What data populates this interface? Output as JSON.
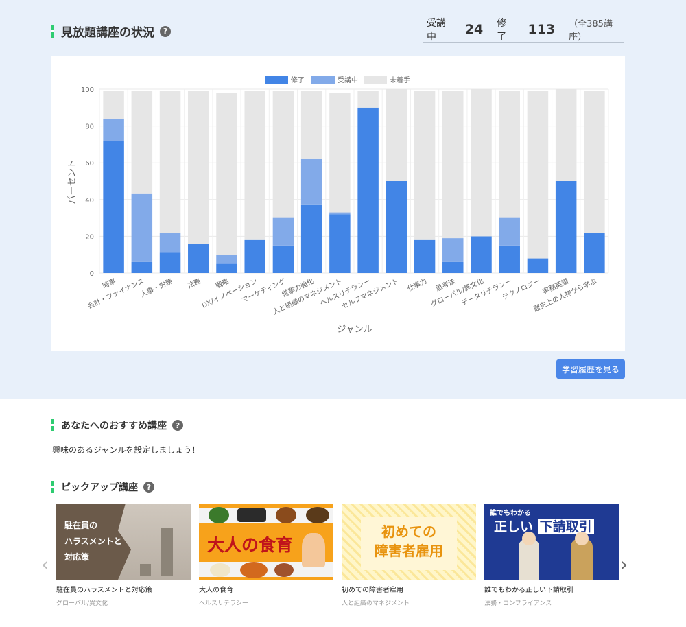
{
  "status_section": {
    "title": "見放題講座の状況",
    "help": "?",
    "stats": {
      "in_progress_label": "受講中",
      "in_progress_value": "24",
      "completed_label": "修了",
      "completed_value": "113",
      "total": "（全385講座）"
    }
  },
  "chart_data": {
    "type": "bar",
    "stacked": true,
    "orientation": "vertical",
    "categories": [
      "時事",
      "会計・ファイナンス",
      "人事・労務",
      "法務",
      "戦略",
      "DX/イノベーション",
      "マーケティング",
      "営業力強化",
      "人と組織のマネジメント",
      "ヘルスリテラシー",
      "セルフマネジメント",
      "仕事力",
      "思考法",
      "グローバル/異文化",
      "データリテラシー",
      "テクノロジー",
      "実務英語",
      "歴史上の人物から学ぶ"
    ],
    "series": [
      {
        "name": "修了",
        "color": "#4285e6",
        "values": [
          72,
          6,
          11,
          16,
          5,
          18,
          15,
          37,
          32,
          90,
          50,
          18,
          6,
          20,
          15,
          8,
          50,
          22
        ]
      },
      {
        "name": "受講中",
        "color": "#82aae9",
        "values": [
          12,
          37,
          11,
          0,
          5,
          0,
          15,
          25,
          1,
          0,
          0,
          0,
          13,
          0,
          15,
          0,
          0,
          0
        ]
      },
      {
        "name": "未着手",
        "color": "#e6e6e6",
        "values": [
          15,
          56,
          77,
          83,
          88,
          81,
          69,
          37,
          65,
          9,
          50,
          81,
          80,
          80,
          69,
          91,
          50,
          77
        ]
      }
    ],
    "xlabel": "ジャンル",
    "ylabel": "パーセント",
    "ylim": [
      0,
      100
    ],
    "yticks": [
      0,
      20,
      40,
      60,
      80,
      100
    ],
    "grid": true,
    "legend": "top-center"
  },
  "history_button": "学習履歴を見る",
  "recommend_section": {
    "title": "あなたへのおすすめ講座",
    "help": "?",
    "message": "興味のあるジャンルを設定しましょう！"
  },
  "pickup_section": {
    "title": "ピックアップ講座",
    "help": "?",
    "prev_arrow": "‹",
    "next_arrow": "›",
    "cards": [
      {
        "title": "駐在員のハラスメントと対応策",
        "genre": "グローバル/異文化",
        "thumb_lines": [
          "駐在員の",
          "ハラスメントと",
          "対応策"
        ]
      },
      {
        "title": "大人の食育",
        "genre": "ヘルスリテラシー",
        "thumb_text": "大人の食育"
      },
      {
        "title": "初めての障害者雇用",
        "genre": "人と組織のマネジメント",
        "thumb_lines": [
          "初めての",
          "障害者雇用"
        ]
      },
      {
        "title": "誰でもわかる正しい下請取引",
        "genre": "法務・コンプライアンス",
        "thumb_small": "誰でもわかる",
        "thumb_main": "正しい",
        "thumb_highlight": "下請取引"
      }
    ]
  }
}
